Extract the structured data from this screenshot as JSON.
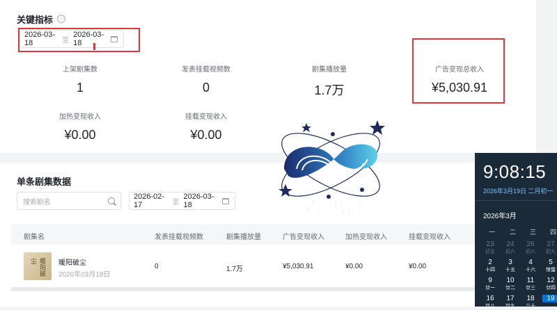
{
  "key_metrics": {
    "title": "关键指标",
    "info_icon": "ⓘ",
    "date_start": "2026-03-18",
    "date_sep": "至",
    "date_end": "2026-03-18",
    "items": [
      {
        "label": "上架剧集数",
        "value": "1"
      },
      {
        "label": "发表挂载视频数",
        "value": "0"
      },
      {
        "label": "剧集播放量",
        "value": "1.7万"
      },
      {
        "label": "广告变现总收入",
        "value": "¥5,030.91"
      },
      {
        "label": "加热变现收入",
        "value": "¥0.00"
      },
      {
        "label": "挂载变现收入",
        "value": "¥0.00"
      }
    ]
  },
  "single_drama": {
    "title": "单条剧集数据",
    "search_placeholder": "搜索剧名",
    "date_start": "2026-02-17",
    "date_sep": "至",
    "date_end": "2026-03-18",
    "columns": [
      "剧集名",
      "发表挂载视频数",
      "剧集播放量",
      "广告变现收入",
      "加热变现收入",
      "挂载变现收入"
    ],
    "rows": [
      {
        "name": "暖阳破尘",
        "date": "2026年03月18日",
        "thumb_text": "暖阳破尘",
        "videos": "0",
        "plays": "1.7万",
        "ad_income": "¥5,030.91",
        "boost_income": "¥0.00",
        "mount_income": "¥0.00"
      }
    ]
  },
  "watermark": {
    "text": "星链共创"
  },
  "clock": {
    "time": "9:08:15",
    "date": "2026年3月19日 二月初一",
    "month": "2026年3月",
    "weekdays": [
      "一",
      "二",
      "三",
      "四"
    ],
    "days": [
      {
        "n": "23",
        "l": "初五"
      },
      {
        "n": "24",
        "l": "初六"
      },
      {
        "n": "26",
        "l": "初八"
      },
      {
        "n": "27",
        "l": "初九"
      },
      {
        "n": "2",
        "l": "十四"
      },
      {
        "n": "3",
        "l": "十五"
      },
      {
        "n": "4",
        "l": "十六"
      },
      {
        "n": "5",
        "l": "惊蛰"
      },
      {
        "n": "9",
        "l": "廿一"
      },
      {
        "n": "10",
        "l": "廿二"
      },
      {
        "n": "11",
        "l": "廿三"
      },
      {
        "n": "12",
        "l": "廿四"
      },
      {
        "n": "16",
        "l": "廿八"
      },
      {
        "n": "17",
        "l": "廿九"
      },
      {
        "n": "18",
        "l": "三十"
      },
      {
        "n": "19",
        "l": ""
      }
    ]
  }
}
